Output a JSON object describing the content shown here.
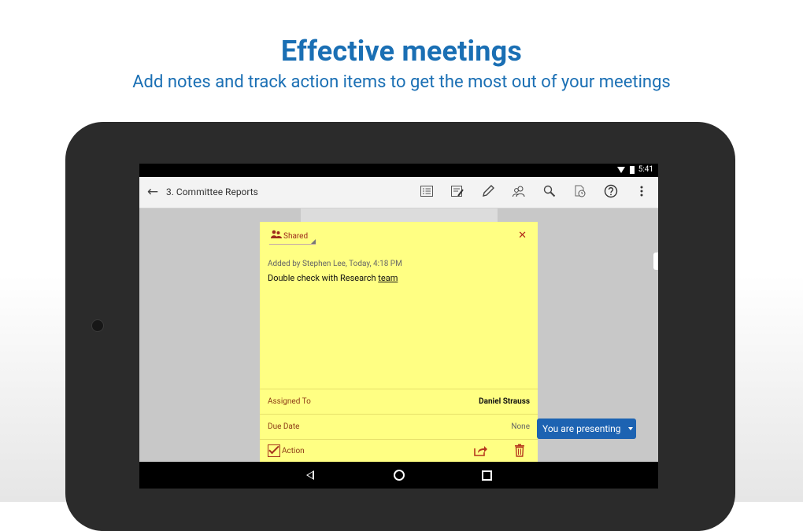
{
  "promo": {
    "headline": "Effective meetings",
    "subheadline": "Add notes and track action items to get the most out of your meetings"
  },
  "status_bar": {
    "time": "5:41"
  },
  "toolbar": {
    "title": "3. Committee Reports",
    "icons": [
      "back-arrow-icon",
      "list-icon",
      "edit-note-icon",
      "pencil-icon",
      "people-icon",
      "search-icon",
      "clock-page-icon",
      "help-icon",
      "overflow-menu-icon"
    ]
  },
  "note": {
    "visibility": "Shared",
    "meta": "Added by Stephen Lee, Today, 4:18 PM",
    "body_prefix": "Double check with Research ",
    "body_underlined": "team",
    "assigned_label": "Assigned To",
    "assigned_value": "Daniel Strauss",
    "due_label": "Due Date",
    "due_value": "None",
    "action_label": "Action",
    "action_checked": true
  },
  "presenting": {
    "label": "You are presenting"
  },
  "colors": {
    "headline": "#1a6fb4",
    "note_bg": "#ffff83",
    "note_accent": "#9e2a1d",
    "presenting_bg": "#1d63b2"
  }
}
